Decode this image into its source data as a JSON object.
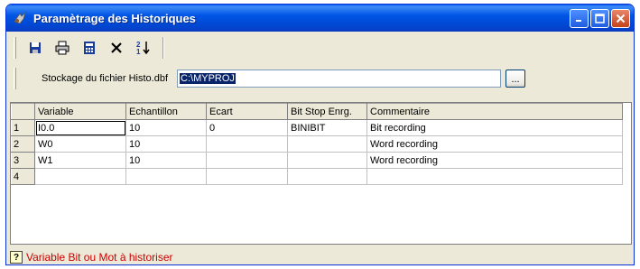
{
  "window": {
    "title": "Paramètrage des Historiques"
  },
  "toolbar": {
    "buttons": [
      "save-icon",
      "print-icon",
      "calculator-icon",
      "delete-icon",
      "sort-icon"
    ]
  },
  "path": {
    "label": "Stockage du fichier Histo.dbf",
    "value": "C:\\MYPROJ",
    "browse_label": "..."
  },
  "grid": {
    "columns": [
      "Variable",
      "Echantillon",
      "Ecart",
      "Bit Stop Enrg.",
      "Commentaire"
    ],
    "rows": [
      {
        "num": "1",
        "variable": "I0.0",
        "echantillon": "10",
        "ecart": "0",
        "bitstop": "BINIBIT",
        "commentaire": "Bit recording"
      },
      {
        "num": "2",
        "variable": "W0",
        "echantillon": "10",
        "ecart": "",
        "bitstop": "",
        "commentaire": "Word recording"
      },
      {
        "num": "3",
        "variable": "W1",
        "echantillon": "10",
        "ecart": "",
        "bitstop": "",
        "commentaire": "Word recording"
      },
      {
        "num": "4",
        "variable": "",
        "echantillon": "",
        "ecart": "",
        "bitstop": "",
        "commentaire": ""
      }
    ]
  },
  "status": {
    "text": "Variable Bit ou Mot à historiser",
    "color": "#cc0000"
  }
}
